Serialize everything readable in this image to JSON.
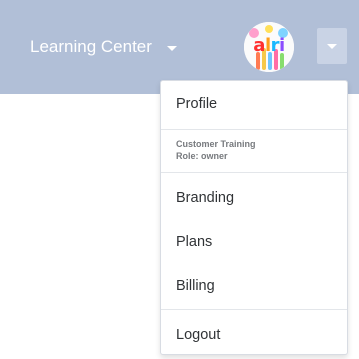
{
  "header": {
    "center_label": "Learning Center",
    "avatar_text": "alri"
  },
  "dropdown": {
    "profile": "Profile",
    "org_name": "Customer Training",
    "role": "Role: owner",
    "branding": "Branding",
    "plans": "Plans",
    "billing": "Billing",
    "logout": "Logout"
  },
  "colors": {
    "header_bg": "#b1bfd7",
    "toggle_bg": "#c9d3e5",
    "menu_text": "#303336",
    "muted_text": "#777a7e"
  },
  "icons": {
    "center_caret": "caret-down-icon",
    "toggle_caret": "caret-down-icon"
  }
}
